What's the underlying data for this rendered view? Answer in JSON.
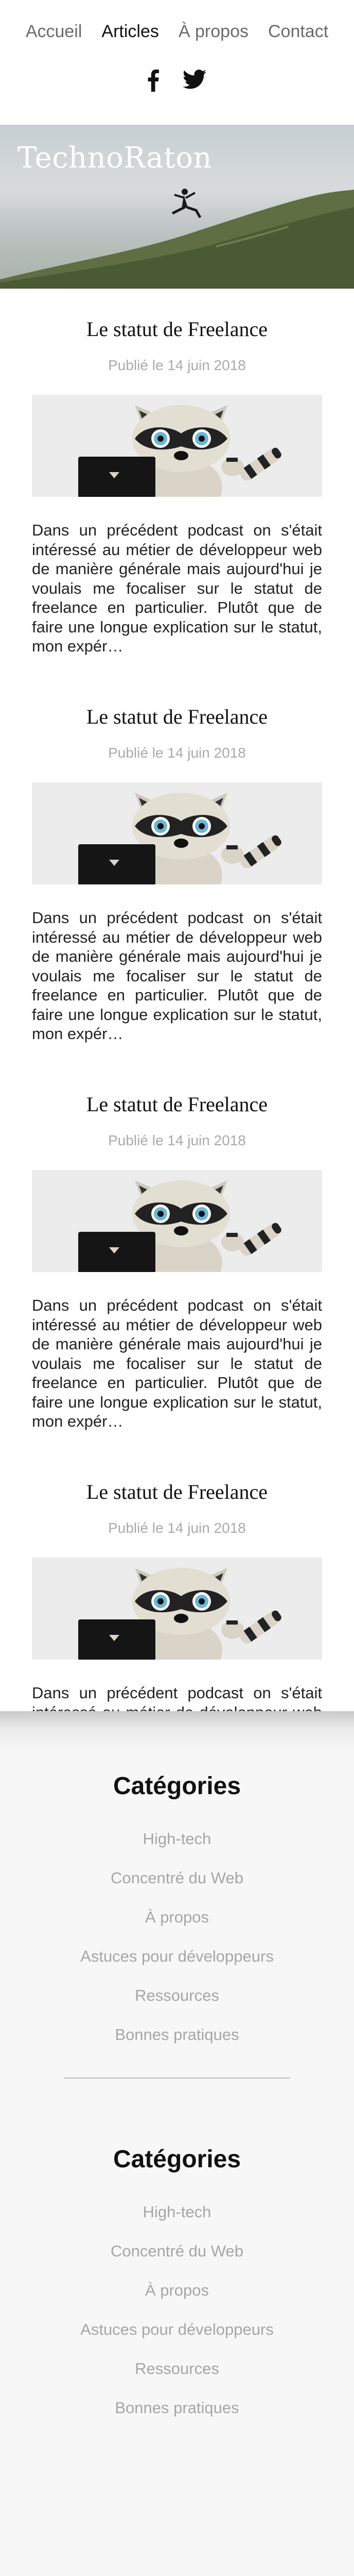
{
  "nav": {
    "links": [
      {
        "label": "Accueil",
        "active": false
      },
      {
        "label": "Articles",
        "active": true
      },
      {
        "label": "À propos",
        "active": false
      },
      {
        "label": "Contact",
        "active": false
      }
    ]
  },
  "social": {
    "icons": [
      "facebook-icon",
      "twitter-icon"
    ]
  },
  "hero": {
    "title": "TechnoRaton"
  },
  "posts": [
    {
      "title": "Le statut de Freelance",
      "date": "Publié le 14 juin 2018",
      "excerpt": "Dans un précédent podcast on s'était intéressé au métier de développeur web de manière générale mais aujourd'hui je voulais me focaliser sur le statut de freelance en particulier. Plutôt que de faire une longue explication sur le statut, mon expér…"
    },
    {
      "title": "Le statut de Freelance",
      "date": "Publié le 14 juin 2018",
      "excerpt": "Dans un précédent podcast on s'était intéressé au métier de développeur web de manière générale mais aujourd'hui je voulais me focaliser sur le statut de freelance en particulier. Plutôt que de faire une longue explication sur le statut, mon expér…"
    },
    {
      "title": "Le statut de Freelance",
      "date": "Publié le 14 juin 2018",
      "excerpt": "Dans un précédent podcast on s'était intéressé au métier de développeur web de manière générale mais aujourd'hui je voulais me focaliser sur le statut de freelance en particulier. Plutôt que de faire une longue explication sur le statut, mon expér…"
    },
    {
      "title": "Le statut de Freelance",
      "date": "Publié le 14 juin 2018",
      "excerpt": "Dans un précédent podcast on s'était intéressé au métier de développeur web de manière générale mais aujourd'hui je voulais me focaliser sur le statut de freelance en particulier. Plutôt que de faire une longue explication sur le statut, mon expér…"
    }
  ],
  "sidebar": {
    "blocks": [
      {
        "heading": "Catégories",
        "items": [
          "High-tech",
          "Concentré du Web",
          "À propos",
          "Astuces pour développeurs",
          "Ressources",
          "Bonnes pratiques"
        ]
      },
      {
        "heading": "Catégories",
        "items": [
          "High-tech",
          "Concentré du Web",
          "À propos",
          "Astuces pour développeurs",
          "Ressources",
          "Bonnes pratiques"
        ]
      }
    ]
  },
  "colors": {
    "nav_inactive": "#6b6b6b",
    "nav_active": "#111111",
    "muted": "#aaaaaa",
    "sidebar_bg": "#f7f7f7"
  }
}
